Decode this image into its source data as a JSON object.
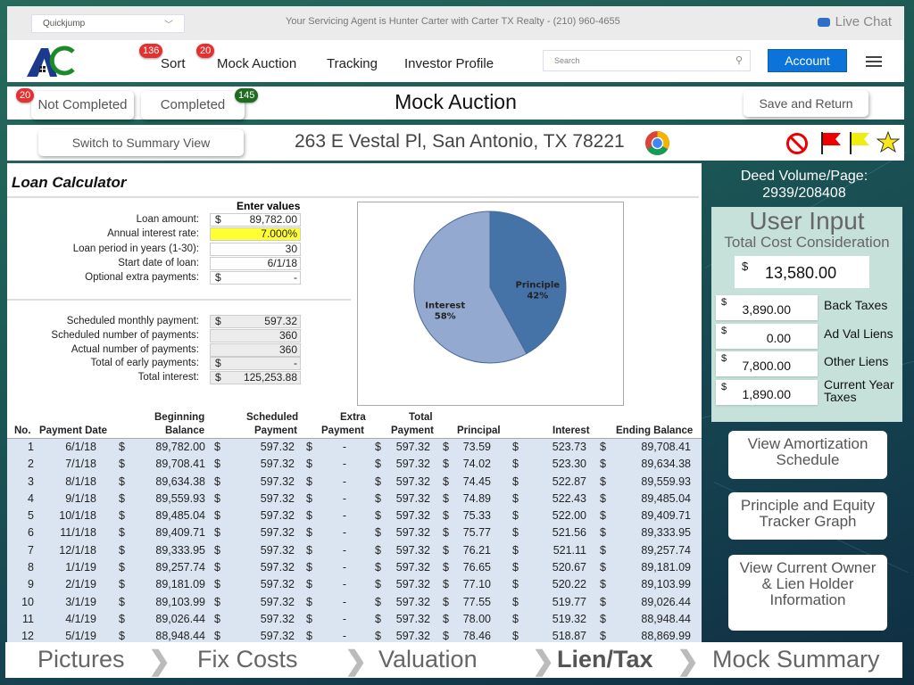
{
  "topbar": {
    "quickjump": "Quickjump",
    "agent_text": "Your Servicing Agent is Hunter Carter with Carter TX Realty - (210) 960-4655",
    "live_chat": "Live Chat"
  },
  "nav": {
    "items": [
      {
        "label": "Sort",
        "badge": "136"
      },
      {
        "label": "Mock Auction",
        "badge": "20"
      },
      {
        "label": "Tracking"
      },
      {
        "label": "Investor Profile"
      }
    ],
    "search_placeholder": "Search",
    "account": "Account"
  },
  "status": {
    "not_completed": "Not Completed",
    "not_completed_count": "20",
    "completed": "Completed",
    "completed_count": "145",
    "title": "Mock Auction",
    "save": "Save and Return"
  },
  "property": {
    "switch_view": "Switch to Summary View",
    "address": "263 E Vestal Pl, San Antonio, TX 78221"
  },
  "calculator": {
    "title": "Loan Calculator",
    "enter_values": "Enter values",
    "inputs": [
      {
        "label": "Loan amount:",
        "dollar": "$",
        "value": "89,782.00"
      },
      {
        "label": "Annual interest rate:",
        "dollar": "",
        "value": "7.000%"
      },
      {
        "label": "Loan period in years (1-30):",
        "dollar": "",
        "value": "30"
      },
      {
        "label": "Start date of loan:",
        "dollar": "",
        "value": "6/1/18"
      },
      {
        "label": "Optional extra payments:",
        "dollar": "$",
        "value": "-"
      }
    ],
    "outputs": [
      {
        "label": "Scheduled monthly payment:",
        "dollar": "$",
        "value": "597.32"
      },
      {
        "label": "Scheduled number of payments:",
        "dollar": "",
        "value": "360"
      },
      {
        "label": "Actual number of payments:",
        "dollar": "",
        "value": "360"
      },
      {
        "label": "Total of early payments:",
        "dollar": "$",
        "value": "-"
      },
      {
        "label": "Total interest:",
        "dollar": "$",
        "value": "125,253.88"
      }
    ],
    "highlight_color": "#ffff33"
  },
  "chart_data": {
    "type": "pie",
    "title": "",
    "slices": [
      {
        "label": "Principle",
        "value": 42,
        "pct": "42%",
        "color": "#4572a7"
      },
      {
        "label": "Interest",
        "value": 58,
        "pct": "58%",
        "color": "#93a9cf"
      }
    ]
  },
  "table": {
    "headers": {
      "no": "No.",
      "date": "Payment Date",
      "beg1": "Beginning",
      "beg2": "Balance",
      "sch1": "Scheduled",
      "sch2": "Payment",
      "ext1": "Extra",
      "ext2": "Payment",
      "tot1": "Total",
      "tot2": "Payment",
      "principal": "Principal",
      "interest": "Interest",
      "ending": "Ending Balance"
    },
    "rows": [
      [
        "1",
        "6/1/18",
        "89,782.00",
        "597.32",
        "-",
        "597.32",
        "73.59",
        "523.73",
        "89,708.41"
      ],
      [
        "2",
        "7/1/18",
        "89,708.41",
        "597.32",
        "-",
        "597.32",
        "74.02",
        "523.30",
        "89,634.38"
      ],
      [
        "3",
        "8/1/18",
        "89,634.38",
        "597.32",
        "-",
        "597.32",
        "74.45",
        "522.87",
        "89,559.93"
      ],
      [
        "4",
        "9/1/18",
        "89,559.93",
        "597.32",
        "-",
        "597.32",
        "74.89",
        "522.43",
        "89,485.04"
      ],
      [
        "5",
        "10/1/18",
        "89,485.04",
        "597.32",
        "-",
        "597.32",
        "75.33",
        "522.00",
        "89,409.71"
      ],
      [
        "6",
        "11/1/18",
        "89,409.71",
        "597.32",
        "-",
        "597.32",
        "75.77",
        "521.56",
        "89,333.95"
      ],
      [
        "7",
        "12/1/18",
        "89,333.95",
        "597.32",
        "-",
        "597.32",
        "76.21",
        "521.11",
        "89,257.74"
      ],
      [
        "8",
        "1/1/19",
        "89,257.74",
        "597.32",
        "-",
        "597.32",
        "76.65",
        "520.67",
        "89,181.09"
      ],
      [
        "9",
        "2/1/19",
        "89,181.09",
        "597.32",
        "-",
        "597.32",
        "77.10",
        "520.22",
        "89,103.99"
      ],
      [
        "10",
        "3/1/19",
        "89,103.99",
        "597.32",
        "-",
        "597.32",
        "77.55",
        "519.77",
        "89,026.44"
      ],
      [
        "11",
        "4/1/19",
        "89,026.44",
        "597.32",
        "-",
        "597.32",
        "78.00",
        "519.32",
        "88,948.44"
      ],
      [
        "12",
        "5/1/19",
        "88,948.44",
        "597.32",
        "-",
        "597.32",
        "78.46",
        "518.87",
        "88,869.99"
      ]
    ]
  },
  "side": {
    "deed_label": "Deed Volume/Page:",
    "deed_value": "2939/208408",
    "user_input": "User Input",
    "total_cost_label": "Total Cost Consideration",
    "total_cost": "13,580.00",
    "fields": [
      {
        "value": "3,890.00",
        "label": "Back Taxes"
      },
      {
        "value": "0.00",
        "label": "Ad Val Liens"
      },
      {
        "value": "7,800.00",
        "label": "Other Liens"
      },
      {
        "value": "1,890.00",
        "label": "Current Year Taxes"
      }
    ],
    "buttons": [
      "View Amortization Schedule",
      "Principle and Equity Tracker Graph",
      "View Current Owner & Lien Holder Information"
    ]
  },
  "breadcrumbs": [
    "Pictures",
    "Fix Costs",
    "Valuation",
    "Lien/Tax",
    "Mock Summary"
  ],
  "active_crumb": "Lien/Tax"
}
